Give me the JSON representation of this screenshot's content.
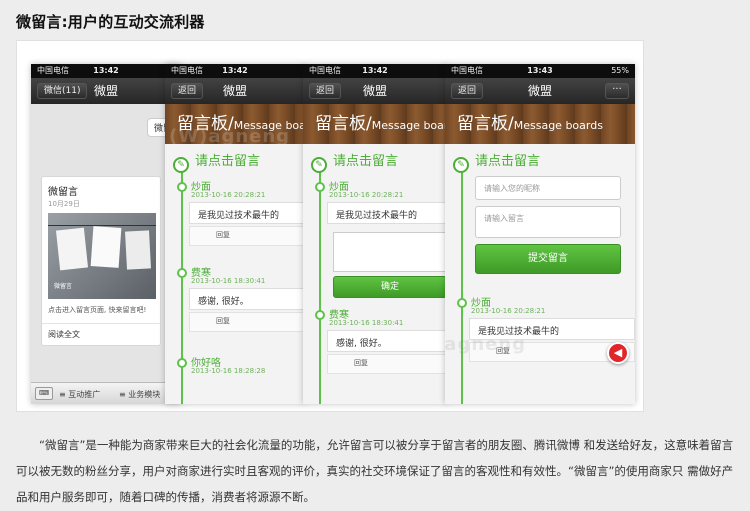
{
  "heading": "微留言:用户的互动交流利器",
  "watermark": "(W)agneng",
  "status": {
    "carrier": "中国电信",
    "wifi": "令",
    "battery": "55%"
  },
  "phone1": {
    "time": "13:42",
    "back": "微信(11)",
    "title": "微盟",
    "bubble": "微留",
    "card_title": "微留言",
    "card_date": "10月29日",
    "photo_caption": "微留言",
    "card_desc": "点击进入留言页面, 快来留言吧!",
    "read_more": "阅读全文",
    "tab1": "互动推广",
    "tab2": "业务模块"
  },
  "phone2": {
    "time": "13:42",
    "back": "返回",
    "title": "微盟",
    "banner": "留言板/",
    "banner_en": "Message boards",
    "cta": "请点击留言",
    "msg1_name": "炒面",
    "msg1_date": "2013-10-16 20:28:21",
    "msg1_text": "是我见过技术最牛的",
    "reply": "回复",
    "msg2_name": "费寒",
    "msg2_date": "2013-10-16 18:30:41",
    "msg2_text": "感谢, 很好。",
    "msg3_name": "你好咯",
    "msg3_date": "2013-10-16 18:28:28"
  },
  "phone3": {
    "time": "13:42",
    "back": "返回",
    "title": "微盟",
    "banner": "留言板/",
    "banner_en": "Message boards",
    "cta": "请点击留言",
    "msg1_name": "炒面",
    "msg1_date": "2013-10-16 20:28:21",
    "msg1_text": "是我见过技术最牛的",
    "reply": "回复",
    "confirm": "确定",
    "msg2_name": "费寒",
    "msg2_date": "2013-10-16 18:30:41",
    "msg2_text": "感谢, 很好。"
  },
  "phone4": {
    "time": "13:43",
    "back": "返回",
    "title": "微盟",
    "more": "···",
    "banner": "留言板/",
    "banner_en": "Message boards",
    "cta": "请点击留言",
    "nickname_placeholder": "请输入您的昵称",
    "message_placeholder": "请输入留言",
    "submit": "提交留言",
    "msg1_name": "炒面",
    "msg1_date": "2013-10-16 20:28:21",
    "msg1_text": "是我见过技术最牛的",
    "reply": "回复"
  },
  "paragraph": "“微留言”是一种能为商家带来巨大的社会化流量的功能，允许留言可以被分享于留言者的朋友圈、腾讯微博 和发送给好友，这意味着留言可以被无数的粉丝分享，用户对商家进行实时且客观的评价，真实的社交环境保证了留言的客观性和有效性。“微留言”的使用商家只 需做好产品和用户服务即可，随着口碑的传播，消费者将源源不断。"
}
